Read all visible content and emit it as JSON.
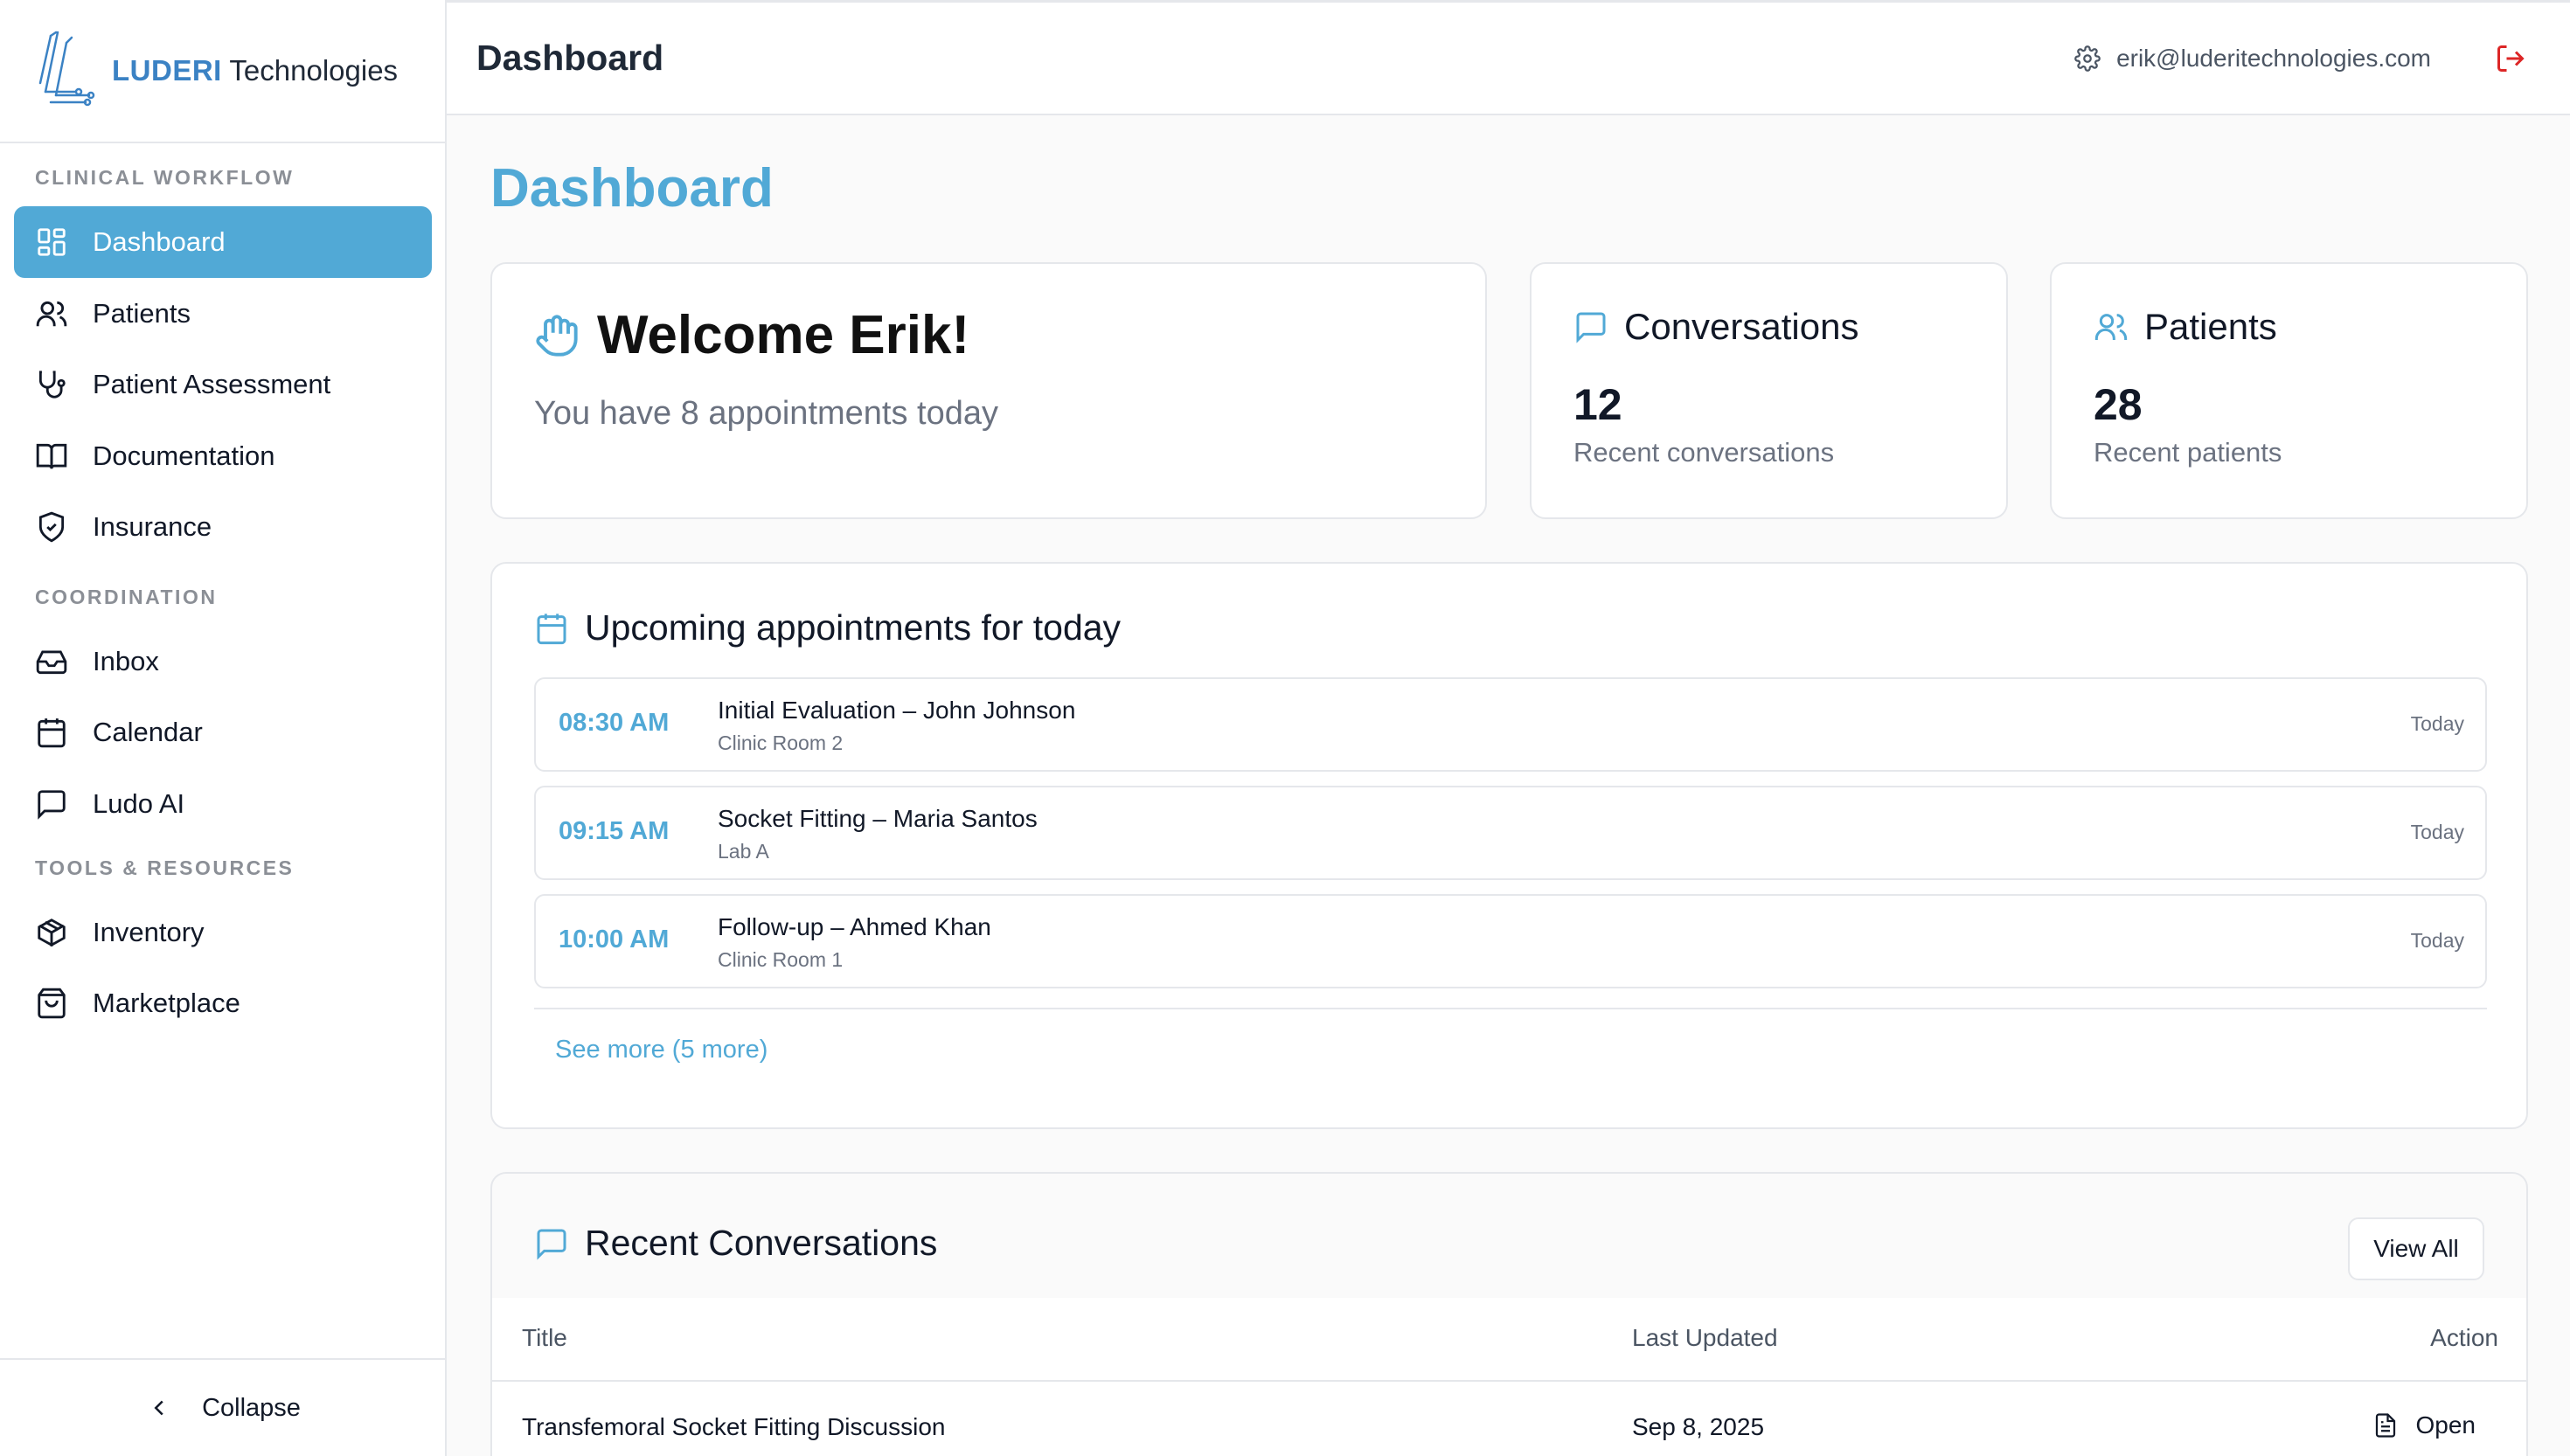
{
  "brand": {
    "name": "LUDERI",
    "suffix": "Technologies"
  },
  "sidebar": {
    "sections": [
      {
        "label": "CLINICAL WORKFLOW"
      },
      {
        "label": "COORDINATION"
      },
      {
        "label": "TOOLS & RESOURCES"
      }
    ],
    "items": [
      {
        "label": "Dashboard",
        "icon": "dashboard-icon",
        "active": true
      },
      {
        "label": "Patients",
        "icon": "users-icon"
      },
      {
        "label": "Patient Assessment",
        "icon": "stethoscope-icon"
      },
      {
        "label": "Documentation",
        "icon": "book-icon"
      },
      {
        "label": "Insurance",
        "icon": "shield-check-icon"
      },
      {
        "label": "Inbox",
        "icon": "inbox-icon"
      },
      {
        "label": "Calendar",
        "icon": "calendar-icon"
      },
      {
        "label": "Ludo AI",
        "icon": "chat-icon"
      },
      {
        "label": "Inventory",
        "icon": "package-icon"
      },
      {
        "label": "Marketplace",
        "icon": "shopping-bag-icon"
      }
    ],
    "collapse_label": "Collapse"
  },
  "header": {
    "title": "Dashboard",
    "user_email": "erik@luderitechnologies.com"
  },
  "main": {
    "title": "Dashboard",
    "welcome": {
      "title": "Welcome Erik!",
      "subtitle": "You have 8 appointments today"
    },
    "stats": [
      {
        "title": "Conversations",
        "value": "12",
        "label": "Recent conversations"
      },
      {
        "title": "Patients",
        "value": "28",
        "label": "Recent patients"
      }
    ],
    "appointments": {
      "title": "Upcoming appointments for today",
      "items": [
        {
          "time": "08:30 AM",
          "title": "Initial Evaluation – John Johnson",
          "location": "Clinic Room 2",
          "day": "Today"
        },
        {
          "time": "09:15 AM",
          "title": "Socket Fitting – Maria Santos",
          "location": "Lab A",
          "day": "Today"
        },
        {
          "time": "10:00 AM",
          "title": "Follow-up – Ahmed Khan",
          "location": "Clinic Room 1",
          "day": "Today"
        }
      ],
      "see_more": "See more (5 more)"
    },
    "conversations": {
      "title": "Recent Conversations",
      "view_all": "View All",
      "columns": [
        "Title",
        "Last Updated",
        "Action"
      ],
      "rows": [
        {
          "title": "Transfemoral Socket Fitting Discussion",
          "updated": "Sep 8, 2025",
          "action": "Open"
        }
      ]
    }
  },
  "colors": {
    "accent": "#51a9d6",
    "logout": "#dc2626"
  }
}
